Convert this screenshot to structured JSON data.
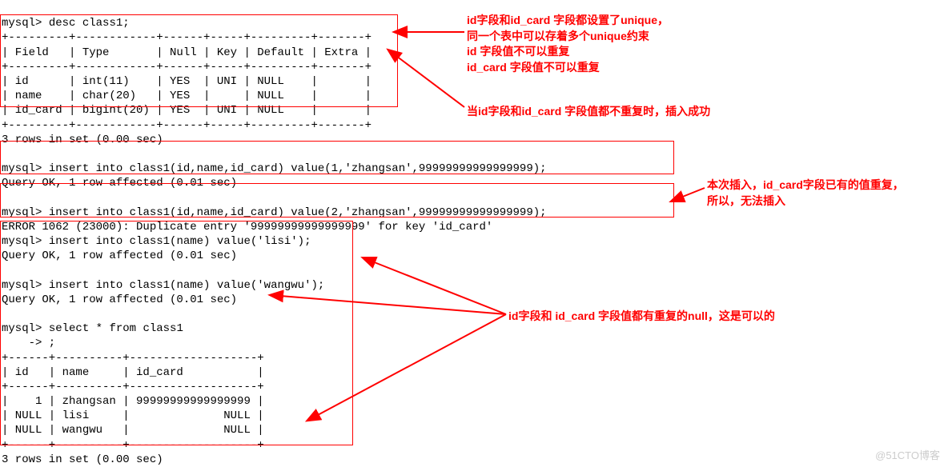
{
  "prompt": "mysql>",
  "commands": {
    "desc": "desc class1;",
    "insert1": "insert into class1(id,name,id_card) value(1,'zhangsan',99999999999999999);",
    "insert2": "insert into class1(id,name,id_card) value(2,'zhangsan',99999999999999999);",
    "insert3": "insert into class1(name) value('lisi');",
    "insert4": "insert into class1(name) value('wangwu');",
    "select": "select * from class1",
    "continuation": "    -> ;"
  },
  "messages": {
    "queryOk": "Query OK, 1 row affected (0.01 sec)",
    "rows3": "3 rows in set (0.00 sec)",
    "error1062": "ERROR 1062 (23000): Duplicate entry '99999999999999999' for key 'id_card'"
  },
  "descTable": {
    "border1": "+---------+------------+------+-----+---------+-------+",
    "header": "| Field   | Type       | Null | Key | Default | Extra |",
    "row1": "| id      | int(11)    | YES  | UNI | NULL    |       |",
    "row2": "| name    | char(20)   | YES  |     | NULL    |       |",
    "row3": "| id_card | bigint(20) | YES  | UNI | NULL    |       |"
  },
  "selectTable": {
    "border": "+------+----------+-------------------+",
    "header": "| id   | name     | id_card           |",
    "row1": "|    1 | zhangsan | 99999999999999999 |",
    "row2": "| NULL | lisi     |              NULL |",
    "row3": "| NULL | wangwu   |              NULL |"
  },
  "annotations": {
    "a1_l1": "id字段和id_card 字段都设置了unique，",
    "a1_l2": "同一个表中可以存着多个unique约束",
    "a1_l3": "id 字段值不可以重复",
    "a1_l4": "id_card 字段值不可以重复",
    "a2": "当id字段和id_card 字段值都不重复时，插入成功",
    "a3_l1": "本次插入，id_card字段已有的值重复，",
    "a3_l2": "所以，无法插入",
    "a4": "id字段和 id_card 字段值都有重复的null，这是可以的"
  },
  "watermark": "@51CTO博客"
}
